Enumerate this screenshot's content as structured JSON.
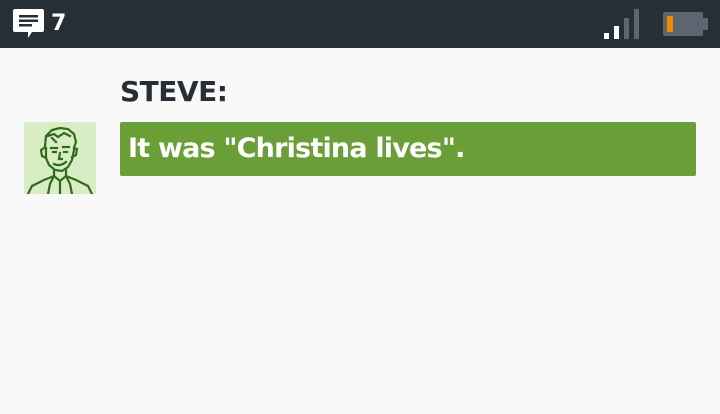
{
  "status_bar": {
    "message_count": "7",
    "icons": [
      "chat-icon",
      "signal-icon",
      "battery-icon"
    ],
    "battery_level": 0.15,
    "signal_bars_active": 2,
    "signal_bars_total": 4,
    "colors": {
      "bar_background": "#262e36",
      "battery_fill": "#f08c00"
    }
  },
  "conversation": {
    "speaker": "STEVE:",
    "message": "It was \"Christina lives\".",
    "avatar_icon": "steve-portrait-icon",
    "colors": {
      "bubble": "#6a9f37",
      "avatar_background": "#d8edc4",
      "avatar_ink": "#2f6b1c"
    }
  }
}
